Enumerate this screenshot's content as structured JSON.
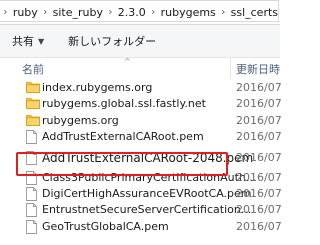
{
  "address": {
    "crumbs": [
      "ruby",
      "site_ruby",
      "2.3.0",
      "rubygems",
      "ssl_certs"
    ]
  },
  "toolbar": {
    "share_label": "共有",
    "new_folder_label": "新しいフォルダー"
  },
  "columns": {
    "name": "名前",
    "date": "更新日時"
  },
  "files": [
    {
      "name": "index.rubygems.org",
      "type": "folder",
      "date": "2016/07"
    },
    {
      "name": "rubygems.global.ssl.fastly.net",
      "type": "folder",
      "date": "2016/07"
    },
    {
      "name": "rubygems.org",
      "type": "folder",
      "date": "2016/07"
    },
    {
      "name": "AddTrustExternalCARoot.pem",
      "type": "file",
      "date": "2016/07"
    },
    {
      "name": "AddTrustExternalCARoot-2048.pem",
      "type": "file",
      "date": "2016/07",
      "highlighted": true
    },
    {
      "name": "Class3PublicPrimaryCertificationAuth...",
      "type": "file",
      "date": "2016/07"
    },
    {
      "name": "DigiCertHighAssuranceEVRootCA.pem",
      "type": "file",
      "date": "2016/07"
    },
    {
      "name": "EntrustnetSecureServerCertification...",
      "type": "file",
      "date": "2016/07"
    },
    {
      "name": "GeoTrustGlobalCA.pem",
      "type": "file",
      "date": "2016/07"
    }
  ],
  "colors": {
    "highlight": "#e02020",
    "folder": "#f2c343",
    "header_text": "#4c607a"
  }
}
